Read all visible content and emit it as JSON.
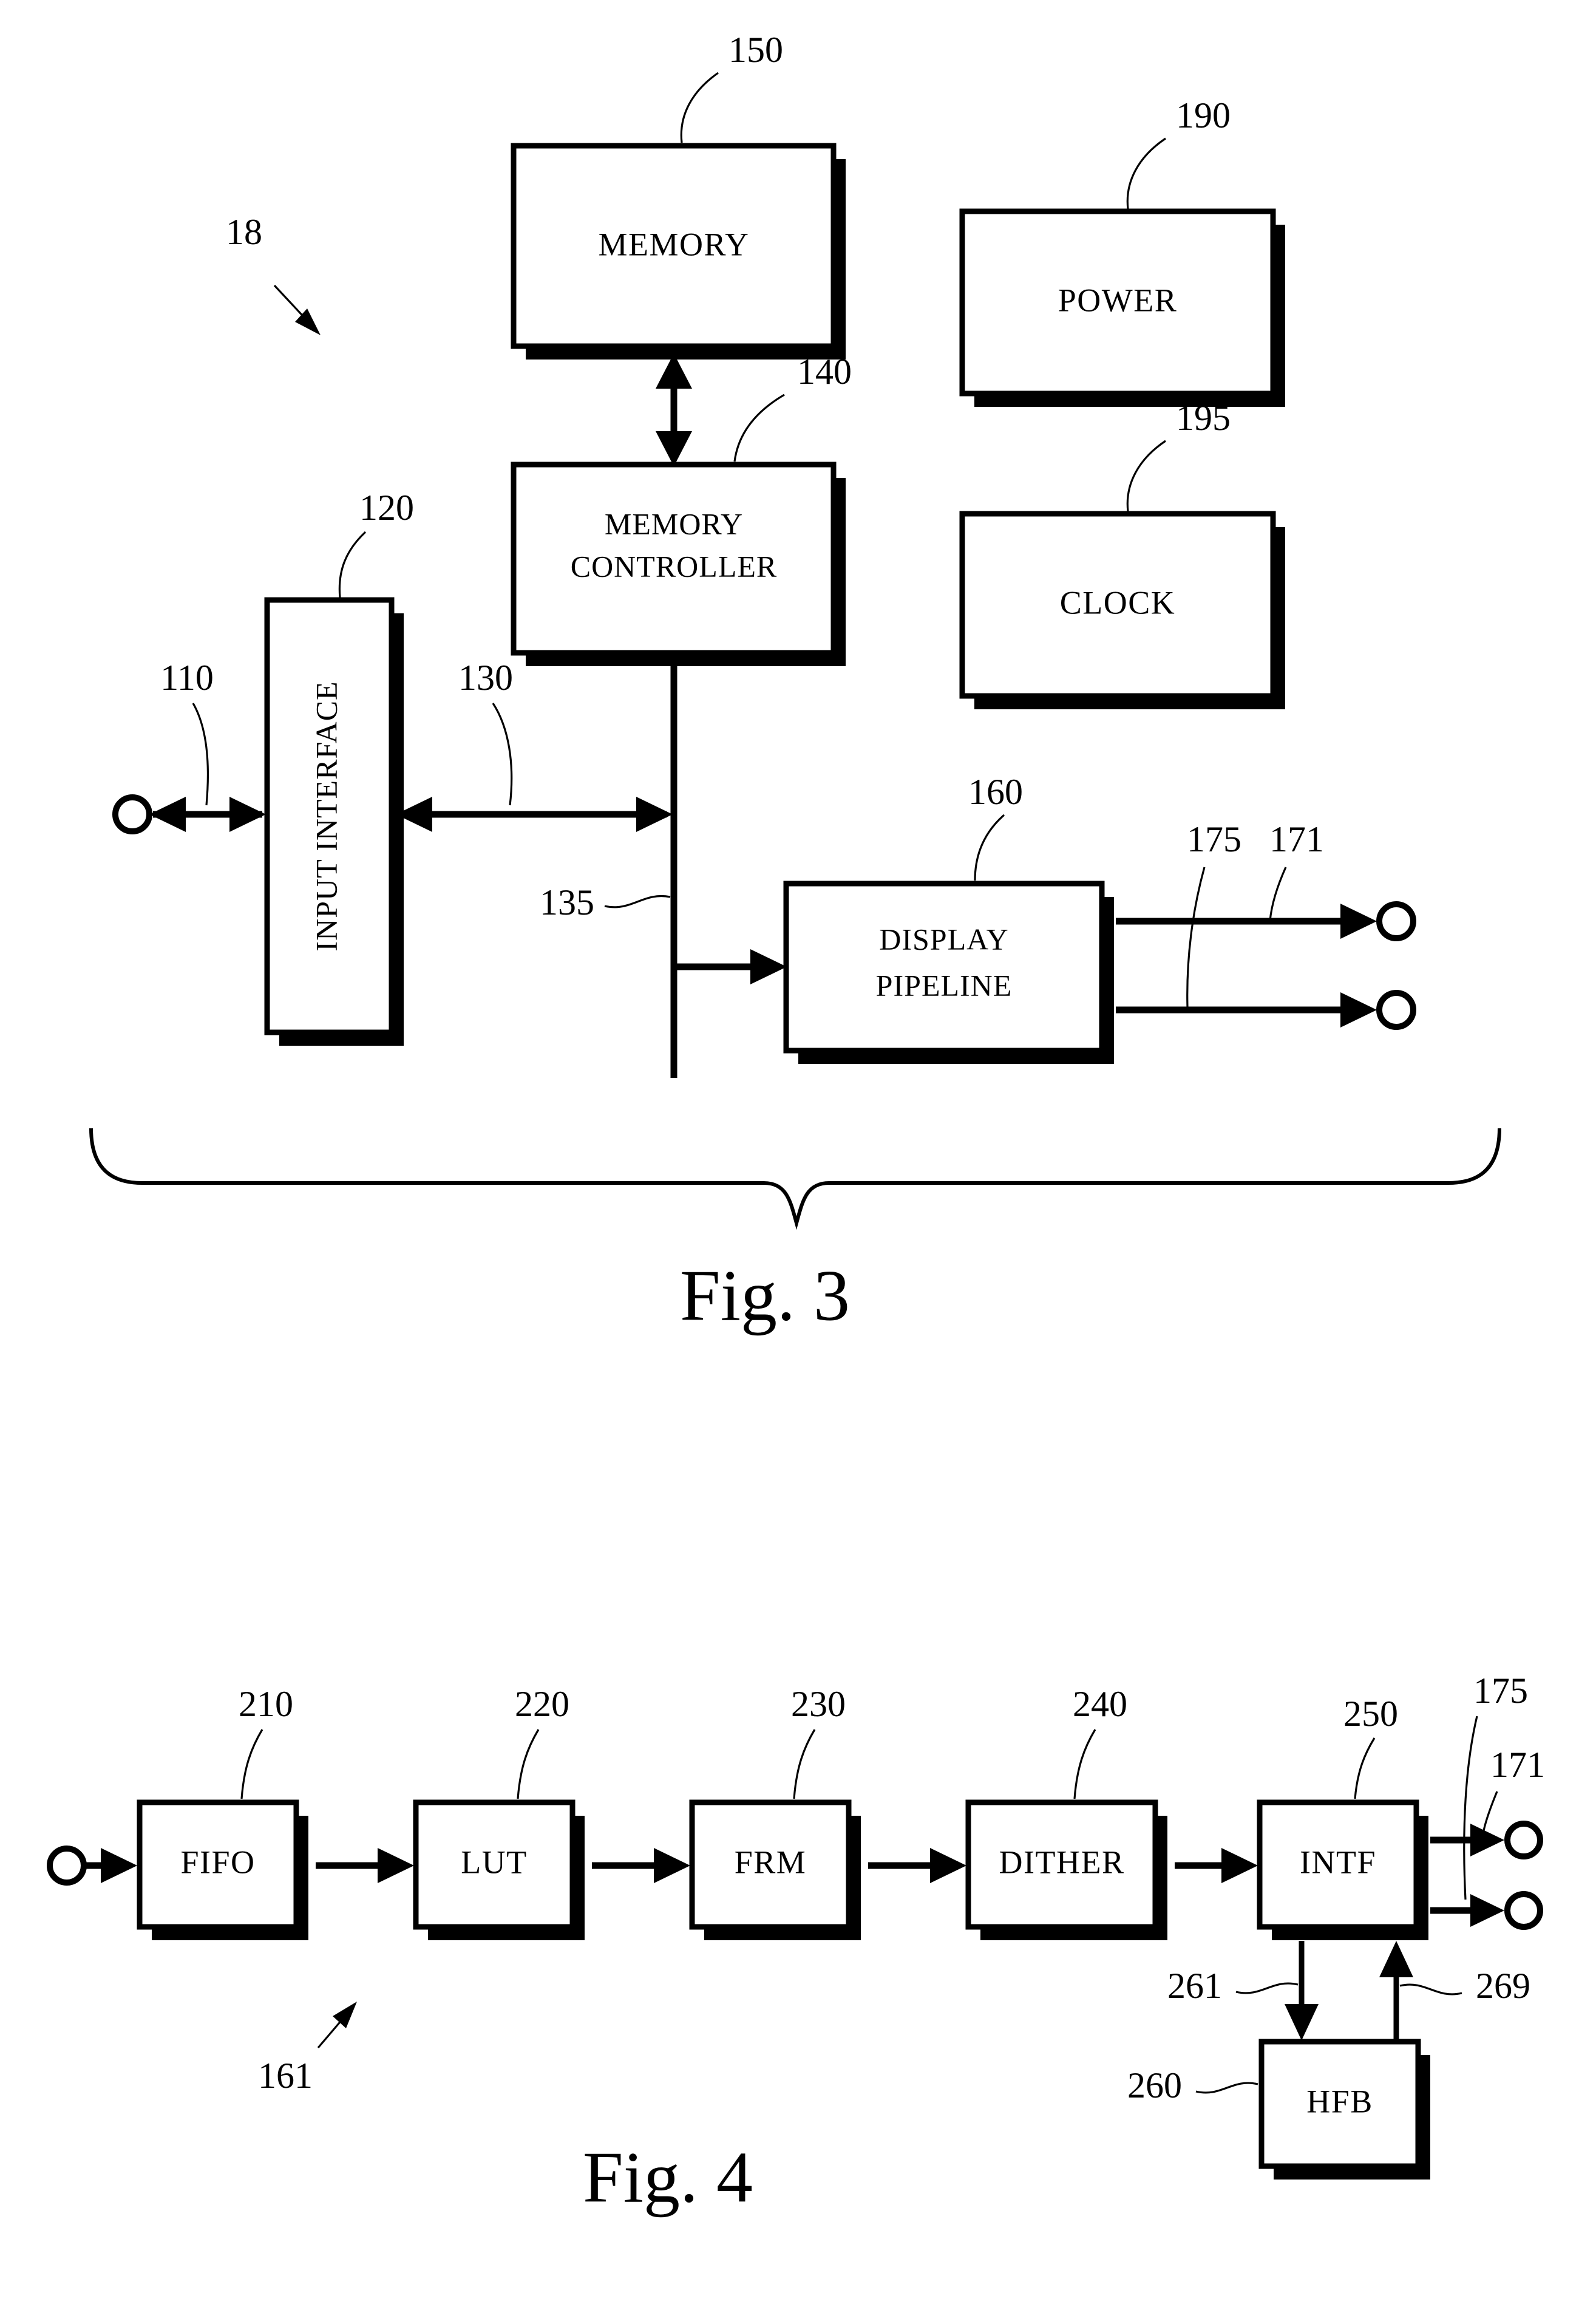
{
  "document": {
    "kind": "patent-drawing-sheet",
    "figures": [
      "Fig. 3",
      "Fig. 4"
    ]
  },
  "figure3": {
    "caption": "Fig. 3",
    "system_ref": "18",
    "blocks": {
      "memory": {
        "label": "MEMORY",
        "ref": "150"
      },
      "memory_controller": {
        "label_line1": "MEMORY",
        "label_line2": "CONTROLLER",
        "ref": "140"
      },
      "input_interface": {
        "label": "INPUT INTERFACE",
        "ref": "120"
      },
      "display_pipeline": {
        "label_line1": "DISPLAY",
        "label_line2": "PIPELINE",
        "ref": "160"
      },
      "power": {
        "label": "POWER",
        "ref": "190"
      },
      "clock": {
        "label": "CLOCK",
        "ref": "195"
      }
    },
    "signals": {
      "host_port": {
        "ref": "110"
      },
      "interface_bus": {
        "ref": "130"
      },
      "pipeline_bus": {
        "ref": "135"
      },
      "output_upper": {
        "ref": "171"
      },
      "output_lower": {
        "ref": "175"
      }
    }
  },
  "figure4": {
    "caption": "Fig. 4",
    "pipeline_ref": "161",
    "blocks": {
      "fifo": {
        "label": "FIFO",
        "ref": "210"
      },
      "lut": {
        "label": "LUT",
        "ref": "220"
      },
      "frm": {
        "label": "FRM",
        "ref": "230"
      },
      "dither": {
        "label": "DITHER",
        "ref": "240"
      },
      "intf": {
        "label": "INTF",
        "ref": "250"
      },
      "hfb": {
        "label": "HFB",
        "ref": "260"
      }
    },
    "signals": {
      "output_upper": {
        "ref": "171"
      },
      "output_lower": {
        "ref": "175"
      },
      "hfb_down": {
        "ref": "261"
      },
      "hfb_up": {
        "ref": "269"
      }
    }
  },
  "colors": {
    "ink": "#000000",
    "paper": "#ffffff"
  }
}
